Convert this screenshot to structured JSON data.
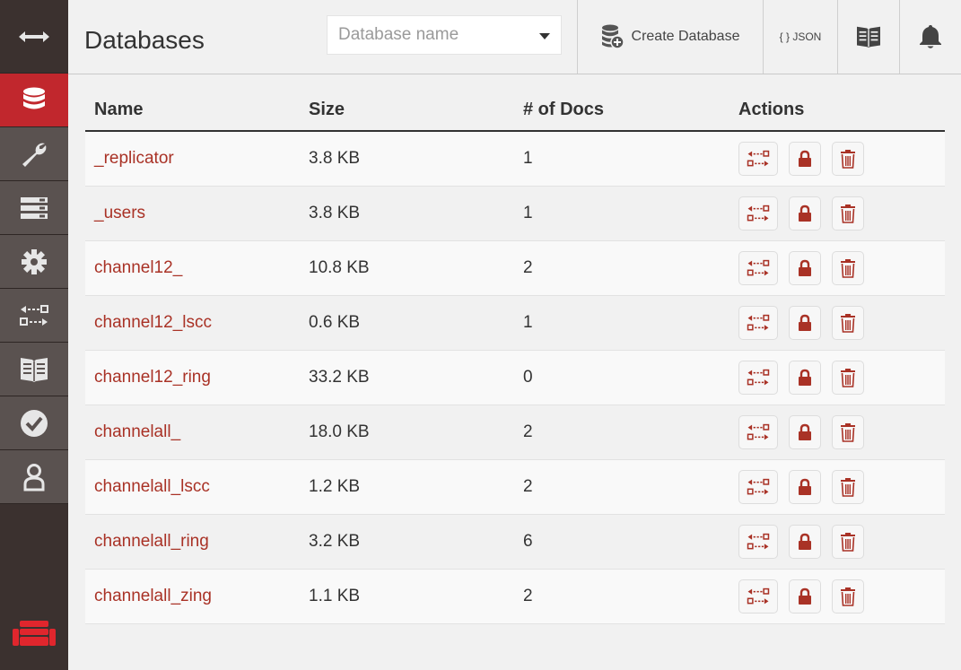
{
  "sidebar": {
    "items": [
      {
        "name": "sidebar-toggle",
        "icon": "expand-arrows-icon"
      },
      {
        "name": "sidebar-item-databases",
        "icon": "database-icon",
        "active": true
      },
      {
        "name": "sidebar-item-setup",
        "icon": "wrench-icon"
      },
      {
        "name": "sidebar-item-active-tasks",
        "icon": "server-icon"
      },
      {
        "name": "sidebar-item-config",
        "icon": "gear-icon"
      },
      {
        "name": "sidebar-item-replication",
        "icon": "replication-icon"
      },
      {
        "name": "sidebar-item-documentation",
        "icon": "book-icon"
      },
      {
        "name": "sidebar-item-verify",
        "icon": "check-circle-icon"
      },
      {
        "name": "sidebar-item-user",
        "icon": "user-icon"
      }
    ],
    "logo_icon": "couch-logo-icon"
  },
  "header": {
    "title": "Databases",
    "search_placeholder": "Database name",
    "create_label": "Create Database",
    "json_label": "{ } JSON"
  },
  "table": {
    "columns": [
      "Name",
      "Size",
      "# of Docs",
      "Actions"
    ],
    "rows": [
      {
        "name": "_replicator",
        "size": "3.8 KB",
        "docs": "1"
      },
      {
        "name": "_users",
        "size": "3.8 KB",
        "docs": "1"
      },
      {
        "name": "channel12_",
        "size": "10.8 KB",
        "docs": "2"
      },
      {
        "name": "channel12_lscc",
        "size": "0.6 KB",
        "docs": "1"
      },
      {
        "name": "channel12_ring",
        "size": "33.2 KB",
        "docs": "0"
      },
      {
        "name": "channelall_",
        "size": "18.0 KB",
        "docs": "2"
      },
      {
        "name": "channelall_lscc",
        "size": "1.2 KB",
        "docs": "2"
      },
      {
        "name": "channelall_ring",
        "size": "3.2 KB",
        "docs": "6"
      },
      {
        "name": "channelall_zing",
        "size": "1.1 KB",
        "docs": "2"
      }
    ]
  },
  "colors": {
    "accent": "#c1272d",
    "link": "#a93226",
    "sidebar_bg": "#3b312f",
    "sidebar_item_bg": "#5a5250"
  }
}
